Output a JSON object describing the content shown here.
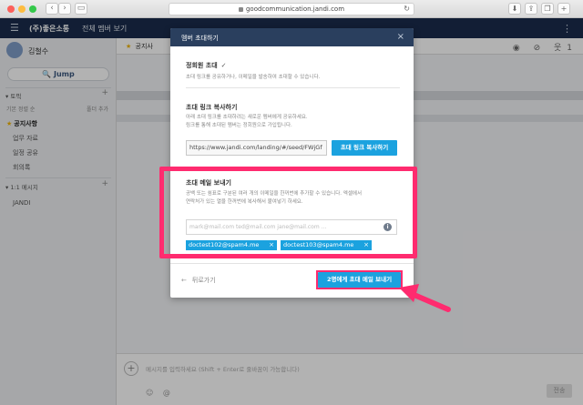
{
  "browser": {
    "url": "goodcommunication.jandi.com",
    "back_glyph": "‹",
    "forward_glyph": "›",
    "sidebar_glyph": "▭",
    "reload_glyph": "↻"
  },
  "topbar": {
    "menu_glyph": "☰",
    "team_name": "(주)좋은소통",
    "all_members_label": "전체 멤버 보기",
    "apps_glyph": "⋮"
  },
  "sidebar": {
    "user_name": "김철수",
    "jump_label": "Jump",
    "topic_header": "토픽",
    "sort_left": "기본 정렬 순",
    "sort_right": "폴더 추가",
    "topics": [
      "공지사항",
      "업무 자료",
      "일정 공유",
      "회의록"
    ],
    "dm_header": "1:1 메시지",
    "dms": [
      "JANDI"
    ],
    "plus_glyph": "+"
  },
  "main": {
    "topic_title": "공지사",
    "header_icons": "◉ ⊘ 웃1",
    "composer_placeholder": "메시지를 입력하세요 (Shift + Enter로 줄바꿈이 가능합니다)",
    "composer_icons": "☺ @",
    "send_label": "전송",
    "plus_glyph": "+"
  },
  "modal": {
    "title": "멤버 초대하기",
    "close_glyph": "×",
    "regular_invite_title": "정회원 초대",
    "check_glyph": "✓",
    "regular_invite_desc": "초대 링크를 공유하거나, 이메일을 발송하여 초대할 수 있습니다.",
    "link_title": "초대 링크 복사하기",
    "link_desc_1": "아래 초대 링크를 초대하려는 새로운 멤버에게 공유하세요.",
    "link_desc_2": "링크를 통해 초대된 멤버는 정회원으로 가입됩니다.",
    "link_value": "https://www.jandi.com/landing/#/seed/FWjGf",
    "copy_button": "초대 링크 복사하기",
    "email_title": "초대 메일 보내기",
    "email_desc_1": "공백 또는 쉼표로 구분된 여러 개의 이메일을 한꺼번에 추가할 수 있습니다. 엑셀에서",
    "email_desc_2": "연락처가 있는 열을 한꺼번에 복사해서 붙여넣기 하세요.",
    "email_placeholder": "mark@mail.com ted@mail.com jane@mail.com ...",
    "info_glyph": "i",
    "chips": [
      "doctest102@spam4.me",
      "doctest103@spam4.me"
    ],
    "chip_close_glyph": "×",
    "back_label": "뒤로가기",
    "back_glyph": "←",
    "send_button": "2명에게 초대 메일 보내기"
  },
  "colors": {
    "accent": "#1ba2df",
    "header_navy": "#1a2c4c",
    "modal_header": "#2a3f5e",
    "highlight": "#ff2b6f"
  }
}
